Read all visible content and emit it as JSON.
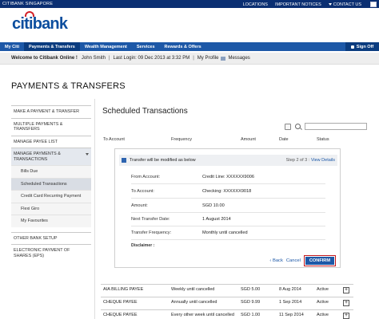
{
  "topbar": {
    "brand": "CITIBANK SINGAPORE",
    "links": [
      "LOCATIONS",
      "IMPORTANT NOTICES",
      "CONTACT US"
    ]
  },
  "logo": {
    "text": "citibank"
  },
  "nav": {
    "items": [
      "My Citi",
      "Payments & Transfers",
      "Wealth Management",
      "Services",
      "Rewards & Offers"
    ],
    "active_index": 1,
    "signoff": "Sign Off"
  },
  "welcome": {
    "greeting": "Welcome to Citibank Online !",
    "name": "John Smith",
    "last_login": "Last Login: 09 Dec 2013 at 3:32 PM",
    "profile": "My Profile",
    "messages": "Messages"
  },
  "page_title": "PAYMENTS & TRANSFERS",
  "sidebar": {
    "items": [
      {
        "label": "MAKE A PAYMENT & TRANSFER"
      },
      {
        "label": "MULTIPLE PAYMENTS & TRANSFERS"
      },
      {
        "label": "MANAGE PAYEE LIST"
      },
      {
        "label": "MANAGE PAYMENTS & TRANSACTIONS"
      },
      {
        "label": "Bills Due"
      },
      {
        "label": "Scheduled Transactions"
      },
      {
        "label": "Credit Card Recurring Payment"
      },
      {
        "label": "Flexi Giro"
      },
      {
        "label": "My Favourites"
      },
      {
        "label": "OTHER BANK SETUP"
      },
      {
        "label": "ELECTRONIC PAYMENT OF SHARES (EPS)"
      }
    ]
  },
  "main": {
    "title": "Scheduled Transactions",
    "columns": [
      "To Account",
      "Frequency",
      "Amount",
      "Date",
      "Status"
    ]
  },
  "modal": {
    "note": "Transfer will be modified as below",
    "step": "Step 2 of 3 :",
    "view_details": "View Details",
    "fields": [
      {
        "label": "From Account:",
        "value": "Credit Line: XXXXXX9006"
      },
      {
        "label": "To Account:",
        "value": "Checking: XXXXXX9018"
      },
      {
        "label": "Amount:",
        "value": "SGD 10.00"
      },
      {
        "label": "Next Transfer Date:",
        "value": "1 August 2014"
      },
      {
        "label": "Transfer Frequency:",
        "value": "Monthly until cancelled"
      },
      {
        "label": "Disclaimer :",
        "value": ""
      }
    ],
    "back": "Back",
    "cancel": "Cancel",
    "confirm": "CONFIRM"
  },
  "rows": [
    {
      "payee": "AIA BILLING PAYEE",
      "frequency": "Weekly until cancelled",
      "amount": "SGD 5.00",
      "date": "8 Aug 2014",
      "status": "Active"
    },
    {
      "payee": "CHEQUE PAYEE",
      "frequency": "Annually until cancelled",
      "amount": "SGD 9.99",
      "date": "1 Sep 2014",
      "status": "Active"
    },
    {
      "payee": "CHEQUE PAYEE",
      "frequency": "Every other week until cancelled",
      "amount": "SGD 1.00",
      "date": "11 Sep 2014",
      "status": "Active"
    }
  ]
}
